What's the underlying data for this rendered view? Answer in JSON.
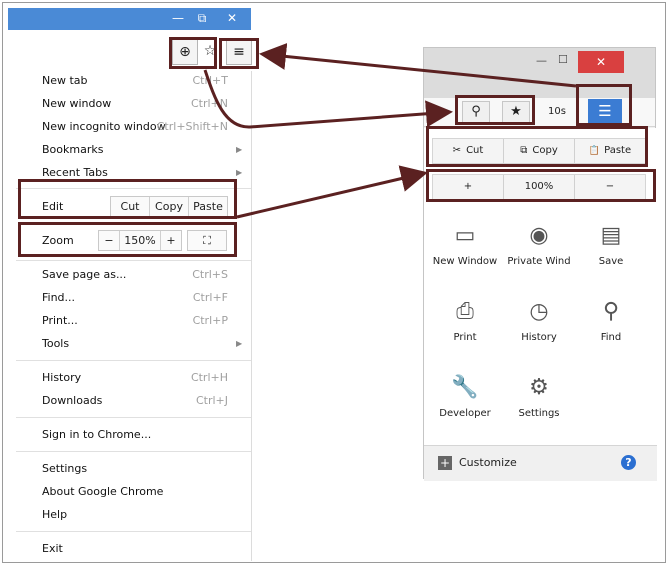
{
  "chrome_window": {
    "controls": {
      "minimize": "—",
      "restore": "⧉",
      "close": "✕"
    },
    "toolbar": {
      "zoom_icon": "⊕",
      "star_icon": "☆",
      "menu_icon": "≡"
    },
    "menu": {
      "new_tab": {
        "label": "New tab",
        "shortcut": "Ctrl+T"
      },
      "new_window": {
        "label": "New window",
        "shortcut": "Ctrl+N"
      },
      "new_incognito": {
        "label": "New incognito window",
        "shortcut": "Ctrl+Shift+N"
      },
      "bookmarks": {
        "label": "Bookmarks"
      },
      "recent_tabs": {
        "label": "Recent Tabs"
      },
      "edit": {
        "label": "Edit",
        "cut": "Cut",
        "copy": "Copy",
        "paste": "Paste"
      },
      "zoom": {
        "label": "Zoom",
        "minus": "−",
        "value": "150%",
        "plus": "+",
        "fullscreen": "⛶"
      },
      "save_page": {
        "label": "Save page as...",
        "shortcut": "Ctrl+S"
      },
      "find": {
        "label": "Find...",
        "shortcut": "Ctrl+F"
      },
      "print": {
        "label": "Print...",
        "shortcut": "Ctrl+P"
      },
      "tools": {
        "label": "Tools"
      },
      "history": {
        "label": "History",
        "shortcut": "Ctrl+H"
      },
      "downloads": {
        "label": "Downloads",
        "shortcut": "Ctrl+J"
      },
      "sign_in": {
        "label": "Sign in to Chrome..."
      },
      "settings": {
        "label": "Settings"
      },
      "about": {
        "label": "About Google Chrome"
      },
      "help": {
        "label": "Help"
      },
      "exit": {
        "label": "Exit"
      },
      "submenu_arrow": "▶"
    }
  },
  "firefox_window": {
    "controls": {
      "minimize": "—",
      "maximize": "☐",
      "close": "✕"
    },
    "toolbar": {
      "search_icon": "⚲",
      "star_icon": "★",
      "counter": "10s",
      "menu_icon": "☰"
    },
    "edit": {
      "cut": "Cut",
      "copy": "Copy",
      "paste": "Paste",
      "cut_icon": "✂",
      "copy_icon": "⧉",
      "paste_icon": "📋"
    },
    "zoom": {
      "plus": "+",
      "value": "100%",
      "minus": "−"
    },
    "tiles": [
      {
        "label": "New Window",
        "icon": "▭"
      },
      {
        "label": "Private Wind",
        "icon": "◉"
      },
      {
        "label": "Save",
        "icon": "▤"
      },
      {
        "label": "Print",
        "icon": "⎙"
      },
      {
        "label": "History",
        "icon": "◷"
      },
      {
        "label": "Find",
        "icon": "⚲"
      },
      {
        "label": "Developer",
        "icon": "🔧"
      },
      {
        "label": "Settings",
        "icon": "⚙"
      }
    ],
    "customize": {
      "label": "Customize",
      "icon": "+",
      "help_icon": "?"
    }
  },
  "colors": {
    "highlight": "#5b2121",
    "chrome_title": "#4a8ad6",
    "firefox_menu": "#3b7cd3",
    "close_red": "#d94040"
  }
}
